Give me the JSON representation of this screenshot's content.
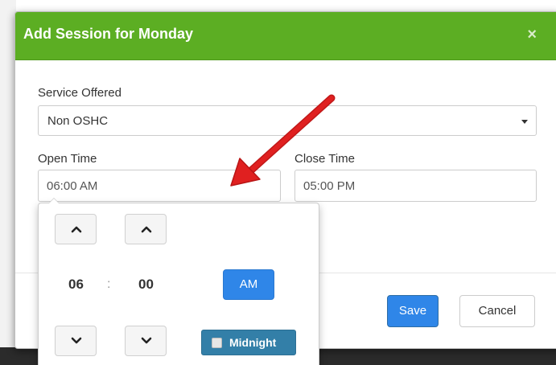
{
  "modal": {
    "title": "Add Session for Monday",
    "close_symbol": "×"
  },
  "form": {
    "service_label": "Service Offered",
    "service_value": "Non OSHC",
    "open_label": "Open Time",
    "open_value": "06:00 AM",
    "close_label": "Close Time",
    "close_value": "05:00 PM"
  },
  "picker": {
    "hour": "06",
    "separator": ":",
    "minute": "00",
    "meridiem": "AM",
    "midnight_label": "Midnight"
  },
  "footer": {
    "save_label": "Save",
    "cancel_label": "Cancel"
  },
  "colors": {
    "header": "#5cae23",
    "primary": "#2f86e8",
    "midnight": "#337fa8",
    "annotation_arrow": "#e02020"
  },
  "icons": [
    "close-icon",
    "dropdown-caret-icon",
    "chevron-up-icon",
    "chevron-down-icon",
    "checkbox-icon",
    "annotation-arrow"
  ]
}
